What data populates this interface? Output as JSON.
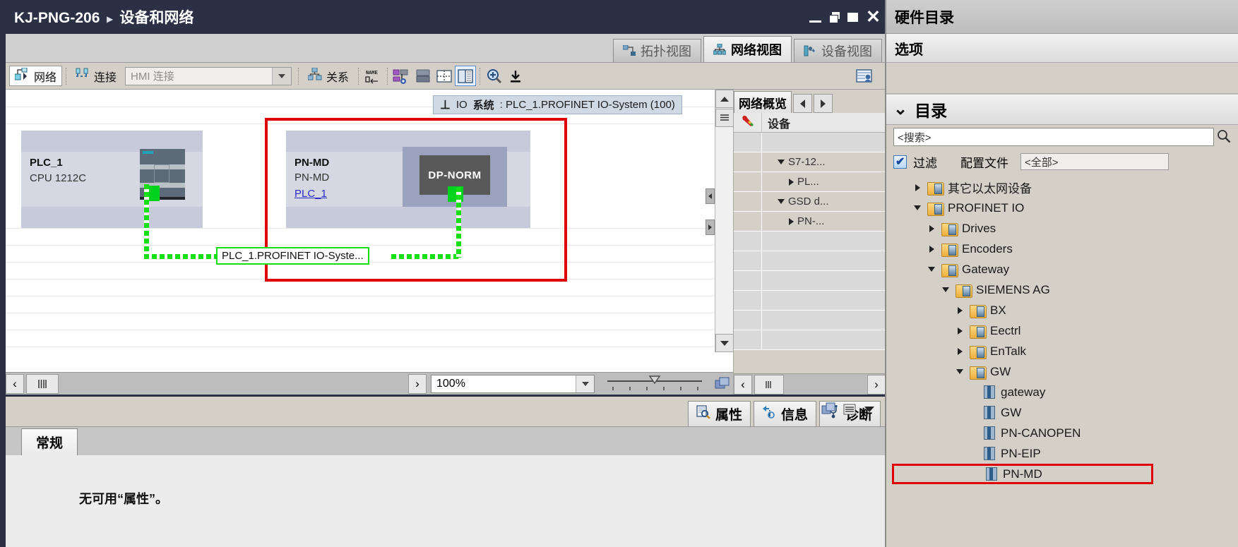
{
  "titlebar": {
    "project": "KJ-PNG-206",
    "separator": "▸",
    "section": "设备和网络",
    "window_buttons": [
      "minimize",
      "restore",
      "maximize",
      "close"
    ]
  },
  "view_tabs": [
    {
      "label": "拓扑视图",
      "icon": "topology-icon",
      "active": false
    },
    {
      "label": "网络视图",
      "icon": "network-icon",
      "active": true
    },
    {
      "label": "设备视图",
      "icon": "device-icon",
      "active": false
    }
  ],
  "toolbar": {
    "network_label": "网络",
    "connection_label": "连接",
    "connection_type_value": "",
    "connection_type_placeholder": "HMI 连接",
    "relations_label": "关系",
    "icons": [
      "name-label-icon",
      "highlight-device-icon",
      "page-break-icon",
      "grid-icon",
      "split-view-icon",
      "zoom-in-icon",
      "zoom-download-icon",
      "user-card-icon"
    ]
  },
  "canvas": {
    "tooltip": {
      "pin": "⊥",
      "prefix": "IO ",
      "label": "系统",
      "value": ": PLC_1.PROFINET IO-System (100)"
    },
    "devices": [
      {
        "name": "PLC_1",
        "type": "CPU 1212C",
        "link": null,
        "module_label": null
      },
      {
        "name": "PN-MD",
        "type": "PN-MD",
        "link": "PLC_1",
        "module_label": "DP-NORM"
      }
    ],
    "io_system_label": "PLC_1.PROFINET IO-Syste...",
    "zoom_level": "100%"
  },
  "network_overview": {
    "tab_label": "网络概览",
    "column_icon": "wrench-icon",
    "column_label": "设备",
    "rows": [
      {
        "label": "",
        "indent": 0,
        "expander": "none"
      },
      {
        "label": "S7-12...",
        "indent": 1,
        "expander": "down"
      },
      {
        "label": "PL...",
        "indent": 2,
        "expander": "right"
      },
      {
        "label": "GSD d...",
        "indent": 1,
        "expander": "down"
      },
      {
        "label": "PN-...",
        "indent": 2,
        "expander": "right"
      },
      {
        "label": "",
        "indent": 0,
        "expander": "none"
      },
      {
        "label": "",
        "indent": 0,
        "expander": "none"
      },
      {
        "label": "",
        "indent": 0,
        "expander": "none"
      },
      {
        "label": "",
        "indent": 0,
        "expander": "none"
      },
      {
        "label": "",
        "indent": 0,
        "expander": "none"
      },
      {
        "label": "",
        "indent": 0,
        "expander": "none"
      }
    ]
  },
  "bottom_panel": {
    "tabs": [
      {
        "label": "属性",
        "icon": "properties-icon",
        "active": true
      },
      {
        "label": "信息",
        "icon": "info-icon",
        "active": false
      },
      {
        "label": "诊断",
        "icon": "diagnostics-icon",
        "active": false
      }
    ],
    "sub_tab": "常规",
    "empty_message": "无可用“属性”。"
  },
  "hardware_catalog": {
    "title": "硬件目录",
    "options_label": "选项",
    "catalog_label": "目录",
    "search_placeholder": "<搜索>",
    "filter_label": "过滤",
    "profile_label": "配置文件",
    "profile_value": "<全部>",
    "tree": [
      {
        "label": "其它以太网设备",
        "level": 1,
        "expander": "right",
        "icon": "folder",
        "highlight": false
      },
      {
        "label": "PROFINET IO",
        "level": 1,
        "expander": "down",
        "icon": "folder",
        "highlight": false
      },
      {
        "label": "Drives",
        "level": 2,
        "expander": "right",
        "icon": "folder",
        "highlight": false
      },
      {
        "label": "Encoders",
        "level": 2,
        "expander": "right",
        "icon": "folder",
        "highlight": false
      },
      {
        "label": "Gateway",
        "level": 2,
        "expander": "down",
        "icon": "folder",
        "highlight": false
      },
      {
        "label": "SIEMENS AG",
        "level": 3,
        "expander": "down",
        "icon": "folder",
        "highlight": false
      },
      {
        "label": "BX",
        "level": 4,
        "expander": "right",
        "icon": "folder",
        "highlight": false
      },
      {
        "label": "Eectrl",
        "level": 4,
        "expander": "right",
        "icon": "folder",
        "highlight": false
      },
      {
        "label": "EnTalk",
        "level": 4,
        "expander": "right",
        "icon": "folder",
        "highlight": false
      },
      {
        "label": "GW",
        "level": 4,
        "expander": "down",
        "icon": "folder",
        "highlight": false
      },
      {
        "label": "gateway",
        "level": 5,
        "expander": "none",
        "icon": "module",
        "highlight": false
      },
      {
        "label": "GW",
        "level": 5,
        "expander": "none",
        "icon": "module",
        "highlight": false
      },
      {
        "label": "PN-CANOPEN",
        "level": 5,
        "expander": "none",
        "icon": "module",
        "highlight": false
      },
      {
        "label": "PN-EIP",
        "level": 5,
        "expander": "none",
        "icon": "module",
        "highlight": false
      },
      {
        "label": "PN-MD",
        "level": 5,
        "expander": "none",
        "icon": "module",
        "highlight": true
      }
    ]
  },
  "colors": {
    "titlebar_bg": "#2b3045",
    "accent_green": "#14e014",
    "highlight_red": "#e00000",
    "panel_bg": "#d4d0c8",
    "device_box": "#c7cada",
    "link_blue": "#2c2cc8"
  }
}
